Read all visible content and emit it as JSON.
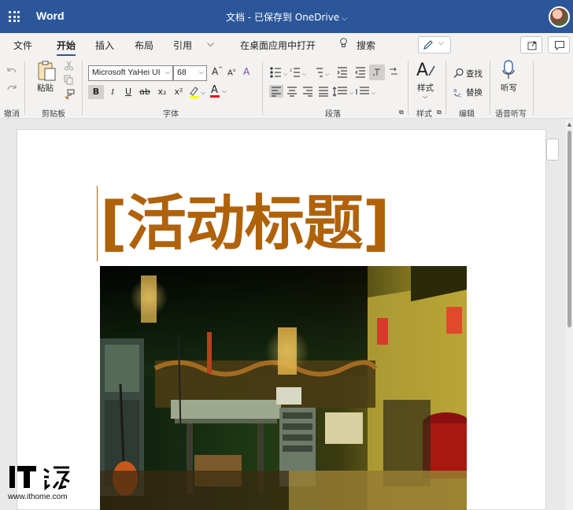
{
  "titlebar": {
    "app_name": "Word",
    "doc_title": "文档 - 已保存到 OneDrive",
    "chev": "⌵"
  },
  "menu": {
    "items": [
      {
        "label": "文件"
      },
      {
        "label": "开始",
        "active": true
      },
      {
        "label": "插入"
      },
      {
        "label": "布局"
      },
      {
        "label": "引用"
      },
      {
        "label": "⌵"
      },
      {
        "label": "在桌面应用中打开"
      },
      {
        "label": "搜索"
      }
    ]
  },
  "ribbon": {
    "undo_group": "撤消",
    "clipboard": {
      "paste": "粘贴",
      "group": "剪贴板"
    },
    "font": {
      "name": "Microsoft YaHei UI",
      "size": "68",
      "group": "字体"
    },
    "paragraph": {
      "group": "段落"
    },
    "styles": {
      "label": "样式",
      "group": "样式"
    },
    "editing": {
      "find": "查找",
      "replace": "替换",
      "group": "编辑"
    },
    "voice": {
      "dictate": "听写",
      "group": "语音听写"
    },
    "format": {
      "bold": "B",
      "italic": "I",
      "underline": "U",
      "strike": "ab",
      "sub": "x₂",
      "sup": "x²"
    }
  },
  "document": {
    "heading": "[活动标题]"
  },
  "watermark": {
    "url": "www.ithome.com"
  },
  "colors": {
    "accent": "#2b579a",
    "heading": "#b0620a"
  }
}
